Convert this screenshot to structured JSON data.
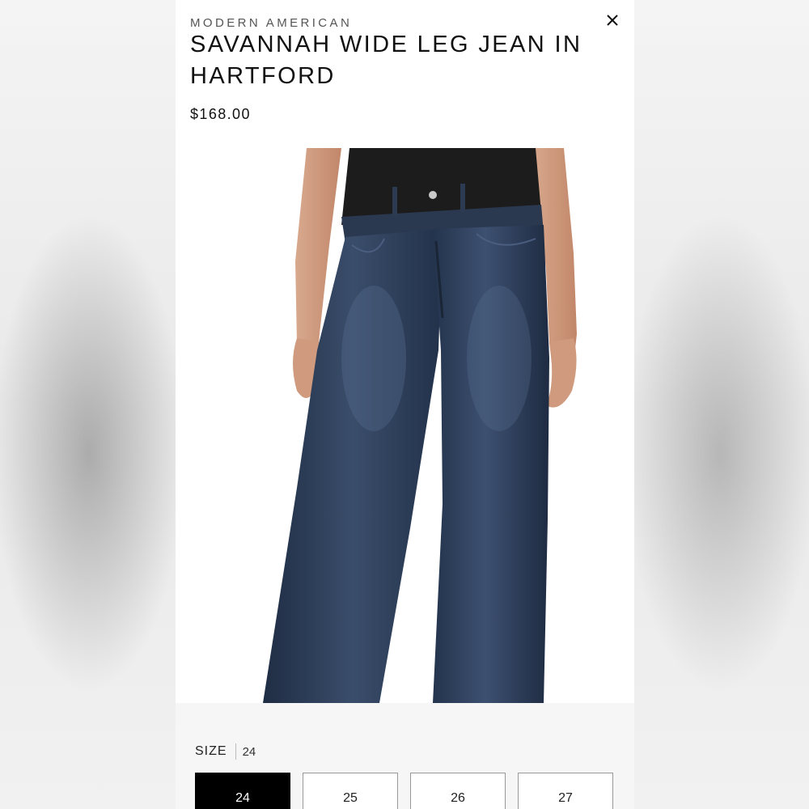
{
  "product": {
    "brand": "MODERN AMERICAN",
    "title": "SAVANNAH WIDE LEG JEAN IN HARTFORD",
    "price": "$168.00"
  },
  "image": {
    "subject": "model-wearing-wide-leg-jeans",
    "denim_color": "#2c3c54",
    "top_color": "#1c1c1c"
  },
  "size_selector": {
    "label": "SIZE",
    "selected_value": "24",
    "options": [
      {
        "label": "24",
        "selected": true
      },
      {
        "label": "25",
        "selected": false
      },
      {
        "label": "26",
        "selected": false
      },
      {
        "label": "27",
        "selected": false
      }
    ]
  },
  "icons": {
    "close": "close-icon"
  }
}
